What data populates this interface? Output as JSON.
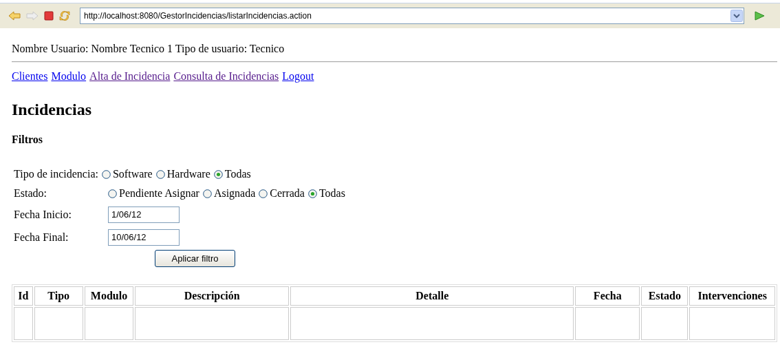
{
  "toolbar": {
    "url": "http://localhost:8080/GestorIncidencias/listarIncidencias.action",
    "forward_disabled": true
  },
  "user_info": "Nombre Usuario: Nombre Tecnico 1 Tipo de usuario: Tecnico",
  "nav_links": [
    {
      "label": "Clientes",
      "visited": false
    },
    {
      "label": "Modulo",
      "visited": false
    },
    {
      "label": "Alta de Incidencia",
      "visited": true
    },
    {
      "label": "Consulta de Incidencias",
      "visited": true
    },
    {
      "label": "Logout",
      "visited": false
    }
  ],
  "heading": "Incidencias",
  "filters": {
    "title": "Filtros",
    "groups": [
      {
        "label": "Tipo de incidencia:",
        "options": [
          {
            "label": "Software",
            "selected": false
          },
          {
            "label": "Hardware",
            "selected": false
          },
          {
            "label": "Todas",
            "selected": true
          }
        ]
      },
      {
        "label": "Estado:",
        "options": [
          {
            "label": "Pendiente Asignar",
            "selected": false
          },
          {
            "label": "Asignada",
            "selected": false
          },
          {
            "label": "Cerrada",
            "selected": false
          },
          {
            "label": "Todas",
            "selected": true
          }
        ]
      }
    ],
    "fields": [
      {
        "label": "Fecha Inicio:",
        "value": "1/06/12"
      },
      {
        "label": "Fecha Final:",
        "value": "10/06/12"
      }
    ],
    "button": "Aplicar filtro"
  },
  "table": {
    "columns": [
      "Id",
      "Tipo",
      "Modulo",
      "Descripción",
      "Detalle",
      "Fecha",
      "Estado",
      "Intervenciones"
    ]
  }
}
